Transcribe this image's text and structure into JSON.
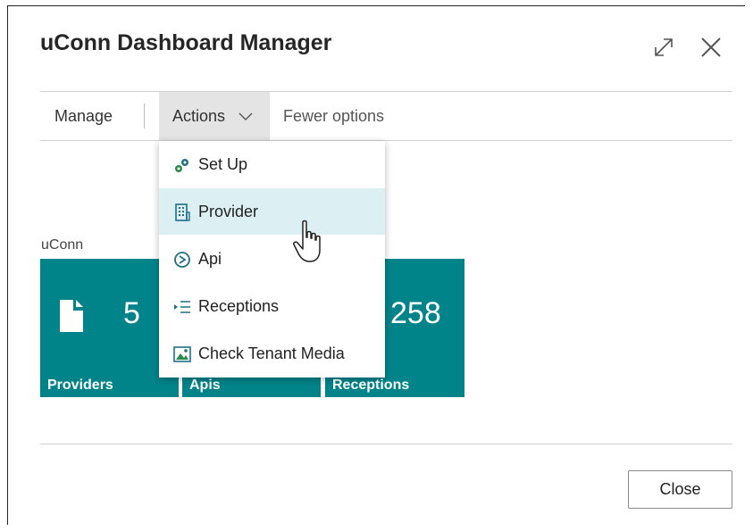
{
  "dialog": {
    "title": "uConn Dashboard Manager",
    "expand_icon": "expand-icon",
    "close_icon": "close-icon"
  },
  "toolbar": {
    "manage_label": "Manage",
    "actions_label": "Actions",
    "fewer_options_label": "Fewer options"
  },
  "actions_menu": {
    "items": [
      {
        "label": "Set Up",
        "icon": "gears-icon"
      },
      {
        "label": "Provider",
        "icon": "building-icon",
        "hovered": true
      },
      {
        "label": "Api",
        "icon": "api-icon"
      },
      {
        "label": "Receptions",
        "icon": "list-indent-icon"
      },
      {
        "label": "Check Tenant Media",
        "icon": "image-icon"
      }
    ]
  },
  "cues": {
    "group_label": "uConn",
    "tiles": [
      {
        "label": "Providers",
        "value": "5",
        "icon": "document-icon"
      },
      {
        "label": "Apis",
        "value": ""
      },
      {
        "label": "Receptions",
        "value": "258"
      }
    ],
    "tile_color": "#00848a"
  },
  "footer": {
    "close_label": "Close"
  },
  "colors": {
    "hover_background": "#dcf0f3",
    "toolbar_active": "#e4e4e4"
  }
}
